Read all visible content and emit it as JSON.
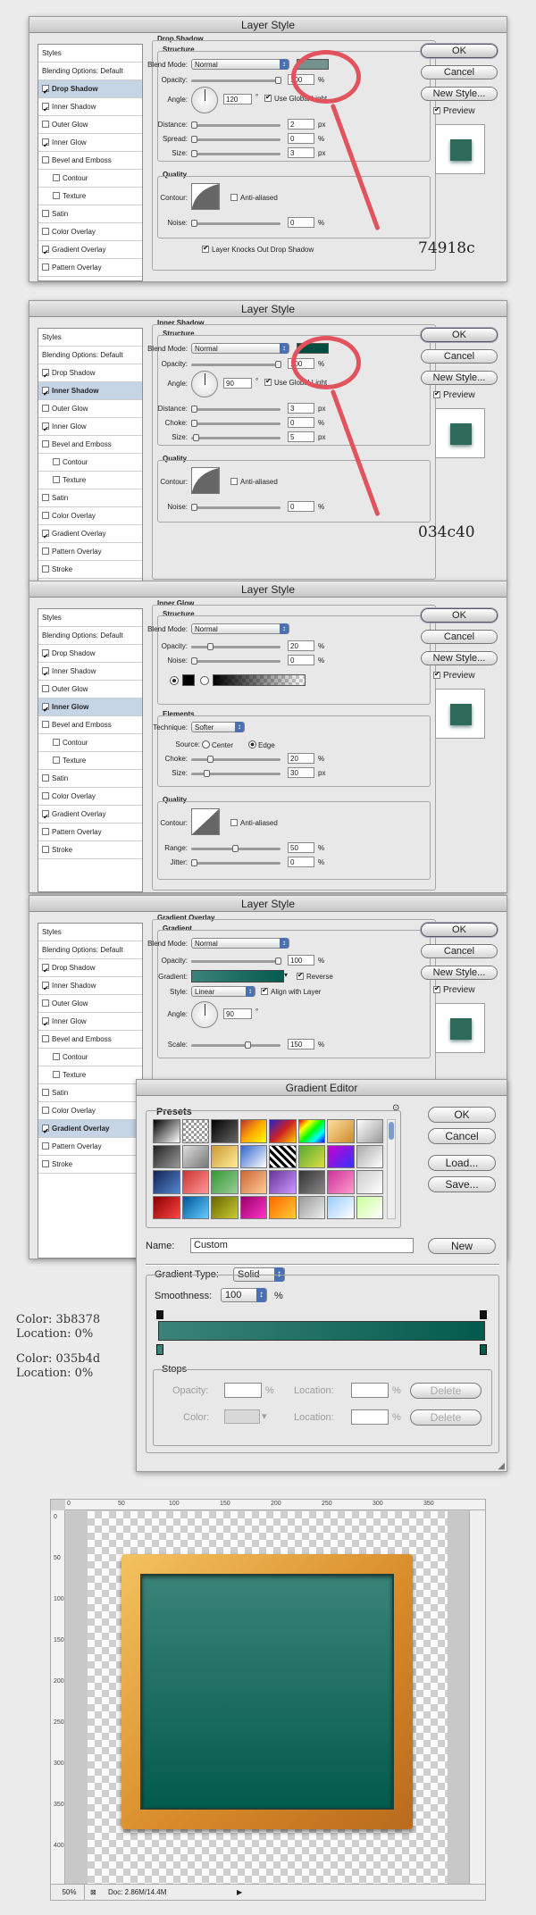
{
  "panels": [
    {
      "title": "Layer Style",
      "styles": [
        {
          "label": "Styles",
          "head": true,
          "check": false,
          "sub": false,
          "selected": false
        },
        {
          "label": "Blending Options: Default",
          "head": true,
          "check": false,
          "sub": false,
          "selected": false
        },
        {
          "label": "Drop Shadow",
          "check": true,
          "checked": true,
          "sub": false,
          "selected": true
        },
        {
          "label": "Inner Shadow",
          "check": true,
          "checked": true,
          "sub": false,
          "selected": false
        },
        {
          "label": "Outer Glow",
          "check": true,
          "checked": false,
          "sub": false,
          "selected": false
        },
        {
          "label": "Inner Glow",
          "check": true,
          "checked": true,
          "sub": false,
          "selected": false
        },
        {
          "label": "Bevel and Emboss",
          "check": true,
          "checked": false,
          "sub": false,
          "selected": false
        },
        {
          "label": "Contour",
          "check": true,
          "checked": false,
          "sub": true,
          "selected": false
        },
        {
          "label": "Texture",
          "check": true,
          "checked": false,
          "sub": true,
          "selected": false
        },
        {
          "label": "Satin",
          "check": true,
          "checked": false,
          "sub": false,
          "selected": false
        },
        {
          "label": "Color Overlay",
          "check": true,
          "checked": false,
          "sub": false,
          "selected": false
        },
        {
          "label": "Gradient Overlay",
          "check": true,
          "checked": true,
          "sub": false,
          "selected": false
        },
        {
          "label": "Pattern Overlay",
          "check": true,
          "checked": false,
          "sub": false,
          "selected": false
        },
        {
          "label": "Stroke",
          "check": true,
          "checked": false,
          "sub": false,
          "selected": false
        }
      ],
      "buttons": {
        "ok": "OK",
        "cancel": "Cancel",
        "new_style": "New Style...",
        "preview": "Preview"
      },
      "section": "Drop Shadow",
      "structure": "Structure",
      "blend_label": "Blend Mode:",
      "blend_value": "Normal",
      "swatch": "#74918c",
      "opacity_label": "Opacity:",
      "opacity": "100",
      "opacity_frac": 1.0,
      "angle_label": "Angle:",
      "angle": "120",
      "deg": "°",
      "global_light": "Use Global Light",
      "distance_label": "Distance:",
      "distance": "2",
      "distance_unit": "px",
      "spread_label": "Spread:",
      "spread": "0",
      "spread_unit": "%",
      "size_label": "Size:",
      "size": "3",
      "size_unit": "px",
      "quality": "Quality",
      "contour_label": "Contour:",
      "anti_aliased": "Anti-aliased",
      "noise_label": "Noise:",
      "noise": "0",
      "noise_unit": "%",
      "knockout": "Layer Knocks Out Drop Shadow",
      "callout": "74918c"
    },
    {
      "title": "Layer Style",
      "styles": [
        {
          "label": "Styles",
          "head": true,
          "check": false,
          "sub": false,
          "selected": false
        },
        {
          "label": "Blending Options: Default",
          "head": true,
          "check": false,
          "sub": false,
          "selected": false
        },
        {
          "label": "Drop Shadow",
          "check": true,
          "checked": true,
          "sub": false,
          "selected": false
        },
        {
          "label": "Inner Shadow",
          "check": true,
          "checked": true,
          "sub": false,
          "selected": true
        },
        {
          "label": "Outer Glow",
          "check": true,
          "checked": false,
          "sub": false,
          "selected": false
        },
        {
          "label": "Inner Glow",
          "check": true,
          "checked": true,
          "sub": false,
          "selected": false
        },
        {
          "label": "Bevel and Emboss",
          "check": true,
          "checked": false,
          "sub": false,
          "selected": false
        },
        {
          "label": "Contour",
          "check": true,
          "checked": false,
          "sub": true,
          "selected": false
        },
        {
          "label": "Texture",
          "check": true,
          "checked": false,
          "sub": true,
          "selected": false
        },
        {
          "label": "Satin",
          "check": true,
          "checked": false,
          "sub": false,
          "selected": false
        },
        {
          "label": "Color Overlay",
          "check": true,
          "checked": false,
          "sub": false,
          "selected": false
        },
        {
          "label": "Gradient Overlay",
          "check": true,
          "checked": true,
          "sub": false,
          "selected": false
        },
        {
          "label": "Pattern Overlay",
          "check": true,
          "checked": false,
          "sub": false,
          "selected": false
        },
        {
          "label": "Stroke",
          "check": true,
          "checked": false,
          "sub": false,
          "selected": false
        }
      ],
      "buttons": {
        "ok": "OK",
        "cancel": "Cancel",
        "new_style": "New Style...",
        "preview": "Preview"
      },
      "section": "Inner Shadow",
      "structure": "Structure",
      "blend_label": "Blend Mode:",
      "blend_value": "Normal",
      "swatch": "#034c40",
      "opacity_label": "Opacity:",
      "opacity": "100",
      "opacity_frac": 1.0,
      "angle_label": "Angle:",
      "angle": "90",
      "deg": "°",
      "global_light": "Use Global Light",
      "distance_label": "Distance:",
      "distance": "3",
      "distance_unit": "px",
      "spread_label": "Choke:",
      "spread": "0",
      "spread_unit": "%",
      "size_label": "Size:",
      "size": "5",
      "size_unit": "px",
      "quality": "Quality",
      "contour_label": "Contour:",
      "anti_aliased": "Anti-aliased",
      "noise_label": "Noise:",
      "noise": "0",
      "noise_unit": "%",
      "callout": "034c40"
    },
    {
      "title": "Layer Style",
      "styles": [
        {
          "label": "Styles",
          "head": true,
          "check": false,
          "sub": false,
          "selected": false
        },
        {
          "label": "Blending Options: Default",
          "head": true,
          "check": false,
          "sub": false,
          "selected": false
        },
        {
          "label": "Drop Shadow",
          "check": true,
          "checked": true,
          "sub": false,
          "selected": false
        },
        {
          "label": "Inner Shadow",
          "check": true,
          "checked": true,
          "sub": false,
          "selected": false
        },
        {
          "label": "Outer Glow",
          "check": true,
          "checked": false,
          "sub": false,
          "selected": false
        },
        {
          "label": "Inner Glow",
          "check": true,
          "checked": true,
          "sub": false,
          "selected": true
        },
        {
          "label": "Bevel and Emboss",
          "check": true,
          "checked": false,
          "sub": false,
          "selected": false
        },
        {
          "label": "Contour",
          "check": true,
          "checked": false,
          "sub": true,
          "selected": false
        },
        {
          "label": "Texture",
          "check": true,
          "checked": false,
          "sub": true,
          "selected": false
        },
        {
          "label": "Satin",
          "check": true,
          "checked": false,
          "sub": false,
          "selected": false
        },
        {
          "label": "Color Overlay",
          "check": true,
          "checked": false,
          "sub": false,
          "selected": false
        },
        {
          "label": "Gradient Overlay",
          "check": true,
          "checked": true,
          "sub": false,
          "selected": false
        },
        {
          "label": "Pattern Overlay",
          "check": true,
          "checked": false,
          "sub": false,
          "selected": false
        },
        {
          "label": "Stroke",
          "check": true,
          "checked": false,
          "sub": false,
          "selected": false
        }
      ],
      "buttons": {
        "ok": "OK",
        "cancel": "Cancel",
        "new_style": "New Style...",
        "preview": "Preview"
      },
      "section": "Inner Glow",
      "structure": "Structure",
      "blend_label": "Blend Mode:",
      "blend_value": "Normal",
      "opacity_label": "Opacity:",
      "opacity": "20",
      "opacity_unit": "%",
      "noise_label": "Noise:",
      "noise": "0",
      "noise_unit": "%",
      "elements": "Elements",
      "technique_label": "Technique:",
      "technique": "Softer",
      "source_label": "Source:",
      "center": "Center",
      "edge": "Edge",
      "choke_label": "Choke:",
      "choke": "20",
      "choke_unit": "%",
      "size_label": "Size:",
      "size": "30",
      "size_unit": "px",
      "quality": "Quality",
      "contour_label": "Contour:",
      "anti_aliased": "Anti-aliased",
      "range_label": "Range:",
      "range": "50",
      "range_unit": "%",
      "jitter_label": "Jitter:",
      "jitter": "0",
      "jitter_unit": "%"
    },
    {
      "title": "Layer Style",
      "styles": [
        {
          "label": "Styles",
          "head": true,
          "check": false,
          "sub": false,
          "selected": false
        },
        {
          "label": "Blending Options: Default",
          "head": true,
          "check": false,
          "sub": false,
          "selected": false
        },
        {
          "label": "Drop Shadow",
          "check": true,
          "checked": true,
          "sub": false,
          "selected": false
        },
        {
          "label": "Inner Shadow",
          "check": true,
          "checked": true,
          "sub": false,
          "selected": false
        },
        {
          "label": "Outer Glow",
          "check": true,
          "checked": false,
          "sub": false,
          "selected": false
        },
        {
          "label": "Inner Glow",
          "check": true,
          "checked": true,
          "sub": false,
          "selected": false
        },
        {
          "label": "Bevel and Emboss",
          "check": true,
          "checked": false,
          "sub": false,
          "selected": false
        },
        {
          "label": "Contour",
          "check": true,
          "checked": false,
          "sub": true,
          "selected": false
        },
        {
          "label": "Texture",
          "check": true,
          "checked": false,
          "sub": true,
          "selected": false
        },
        {
          "label": "Satin",
          "check": true,
          "checked": false,
          "sub": false,
          "selected": false
        },
        {
          "label": "Color Overlay",
          "check": true,
          "checked": false,
          "sub": false,
          "selected": false
        },
        {
          "label": "Gradient Overlay",
          "check": true,
          "checked": true,
          "sub": false,
          "selected": true
        },
        {
          "label": "Pattern Overlay",
          "check": true,
          "checked": false,
          "sub": false,
          "selected": false
        },
        {
          "label": "Stroke",
          "check": true,
          "checked": false,
          "sub": false,
          "selected": false
        }
      ],
      "buttons": {
        "ok": "OK",
        "cancel": "Cancel",
        "new_style": "New Style...",
        "preview": "Preview"
      },
      "section": "Gradient Overlay",
      "structure": "Gradient",
      "blend_label": "Blend Mode:",
      "blend_value": "Normal",
      "opacity_label": "Opacity:",
      "opacity": "100",
      "opacity_unit": "%",
      "gradient_label": "Gradient:",
      "reverse": "Reverse",
      "style_label": "Style:",
      "style": "Linear",
      "align": "Align with Layer",
      "angle_label": "Angle:",
      "angle": "90",
      "deg": "°",
      "scale_label": "Scale:",
      "scale": "150",
      "scale_unit": "%"
    }
  ],
  "gradient_editor": {
    "title": "Gradient Editor",
    "presets": "Presets",
    "ok": "OK",
    "cancel": "Cancel",
    "load": "Load...",
    "save": "Save...",
    "name_label": "Name:",
    "name": "Custom",
    "new": "New",
    "type_label": "Gradient Type:",
    "type": "Solid",
    "smoothness_label": "Smoothness:",
    "smoothness": "100",
    "smoothness_unit": "%",
    "stops": "Stops",
    "opacity_label": "Opacity:",
    "location_label": "Location:",
    "color_label": "Color:",
    "pct": "%",
    "delete": "Delete",
    "start_color": "#3b8378",
    "end_color": "#035b4d"
  },
  "notes": {
    "color1": "Color: 3b8378",
    "loc1": "Location: 0%",
    "color2": "Color: 035b4d",
    "loc2": "Location: 0%"
  },
  "canvas": {
    "ruler_h": [
      "0",
      "50",
      "100",
      "150",
      "200",
      "250",
      "300",
      "350"
    ],
    "ruler_v": [
      "0",
      "50",
      "100",
      "150",
      "200",
      "250",
      "300",
      "350",
      "400"
    ],
    "zoom": "50%",
    "doc": "Doc: 2.86M/14.4M",
    "board_colors": [
      "#3b8378",
      "#035b4d"
    ]
  }
}
